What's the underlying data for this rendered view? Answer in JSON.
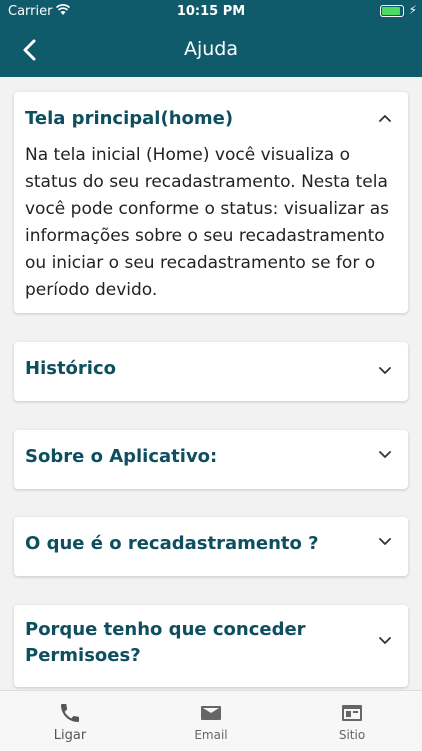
{
  "status": {
    "carrier": "Carrier",
    "time": "10:15 PM"
  },
  "nav": {
    "title": "Ajuda"
  },
  "cards": [
    {
      "title": "Tela principal(home)",
      "body": "Na tela inicial (Home) você visualiza o status do seu recadastramento. Nesta tela você pode conforme o status: visualizar as informações sobre o seu recadastramento ou iniciar o seu recadastramento se for o período devido."
    },
    {
      "title": "Histórico"
    },
    {
      "title": "Sobre o Aplicativo:"
    },
    {
      "title": "O que é o recadastramento ?"
    },
    {
      "title": "Porque tenho que conceder Permisoes?"
    }
  ],
  "tabs": [
    {
      "label": "Ligar",
      "icon": "phone-icon"
    },
    {
      "label": "Email",
      "icon": "email-icon"
    },
    {
      "label": "Sitio",
      "icon": "browser-icon"
    }
  ],
  "colors": {
    "header": "#0f5b6b",
    "title": "#0d4f5e",
    "battery": "#4cd964"
  }
}
